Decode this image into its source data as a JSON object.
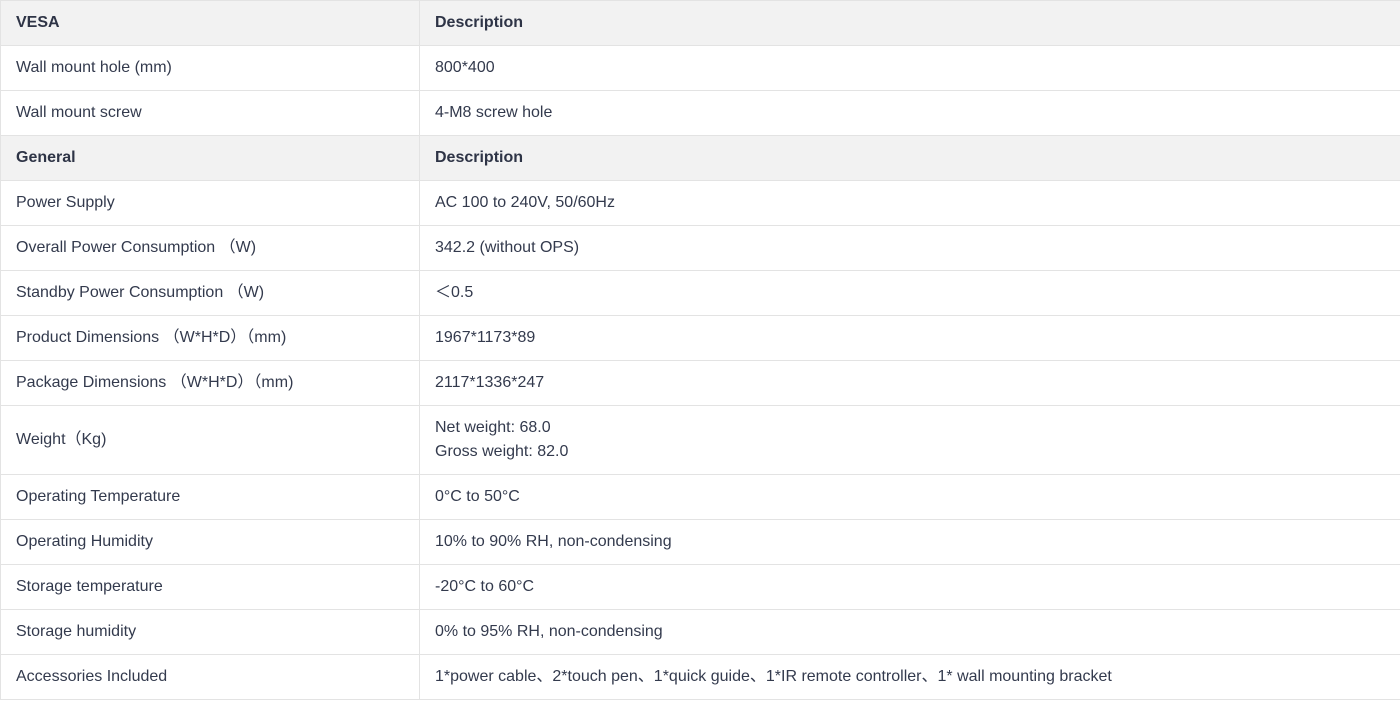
{
  "spec_table": {
    "rows": [
      {
        "type": "header",
        "label": "VESA",
        "value": "Description"
      },
      {
        "type": "row",
        "label": "Wall mount hole (mm)",
        "value": "800*400"
      },
      {
        "type": "row",
        "label": "Wall mount screw",
        "value": "4-M8 screw hole"
      },
      {
        "type": "header",
        "label": "General",
        "value": "Description"
      },
      {
        "type": "row",
        "label": "Power Supply",
        "value": "AC 100 to 240V, 50/60Hz"
      },
      {
        "type": "row",
        "label": "Overall Power Consumption （W)",
        "value": "342.2 (without OPS)"
      },
      {
        "type": "row",
        "label": "Standby Power Consumption （W)",
        "value": "＜0.5"
      },
      {
        "type": "row",
        "label": "Product Dimensions （W*H*D）（mm)",
        "value": "1967*1173*89"
      },
      {
        "type": "row",
        "label": "Package Dimensions （W*H*D）（mm)",
        "value": "2117*1336*247"
      },
      {
        "type": "row",
        "label": "Weight（Kg)",
        "value": "Net weight: 68.0\nGross weight: 82.0"
      },
      {
        "type": "row",
        "label": "Operating Temperature",
        "value": "0°C to 50°C"
      },
      {
        "type": "row",
        "label": "Operating Humidity",
        "value": "10% to 90% RH, non-condensing"
      },
      {
        "type": "row",
        "label": "Storage temperature",
        "value": "-20°C to 60°C"
      },
      {
        "type": "row",
        "label": "Storage humidity",
        "value": "0% to 95% RH, non-condensing"
      },
      {
        "type": "row",
        "label": "Accessories Included",
        "value": "1*power cable、2*touch pen、1*quick guide、1*IR remote controller、1* wall mounting bracket"
      }
    ]
  }
}
